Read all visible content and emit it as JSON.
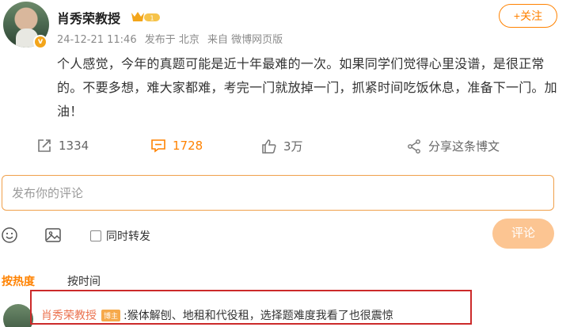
{
  "post": {
    "author": "肖秀荣教授",
    "verified_icon": "v-badge-icon",
    "vip_level": "1",
    "timestamp": "24-12-21 11:46",
    "location": "发布于 北京",
    "source": "来自 微博网页版",
    "follow_label": "+关注",
    "text": "个人感觉，今年的真题可能是近十年最难的一次。如果同学们觉得心里没谱，是很正常的。不要多想，难大家都难，考完一门就放掉一门，抓紧时间吃饭休息，准备下一门。加油！",
    "stats": {
      "repost": "1334",
      "comment": "1728",
      "like": "3万",
      "share_label": "分享这条博文"
    }
  },
  "composer": {
    "placeholder": "发布你的评论",
    "repost_label": "同时转发",
    "submit_label": "评论"
  },
  "sort": {
    "hot": "按热度",
    "time": "按时间"
  },
  "top_comment": {
    "user": "肖秀荣教授",
    "badge": "博主",
    "text": ":猴体解刨、地租和代役租，选择题难度我看了也很震惊"
  },
  "colors": {
    "accent": "#ff8200",
    "submit_disabled": "#fcc592",
    "highlight_border": "#cc2a2a"
  }
}
